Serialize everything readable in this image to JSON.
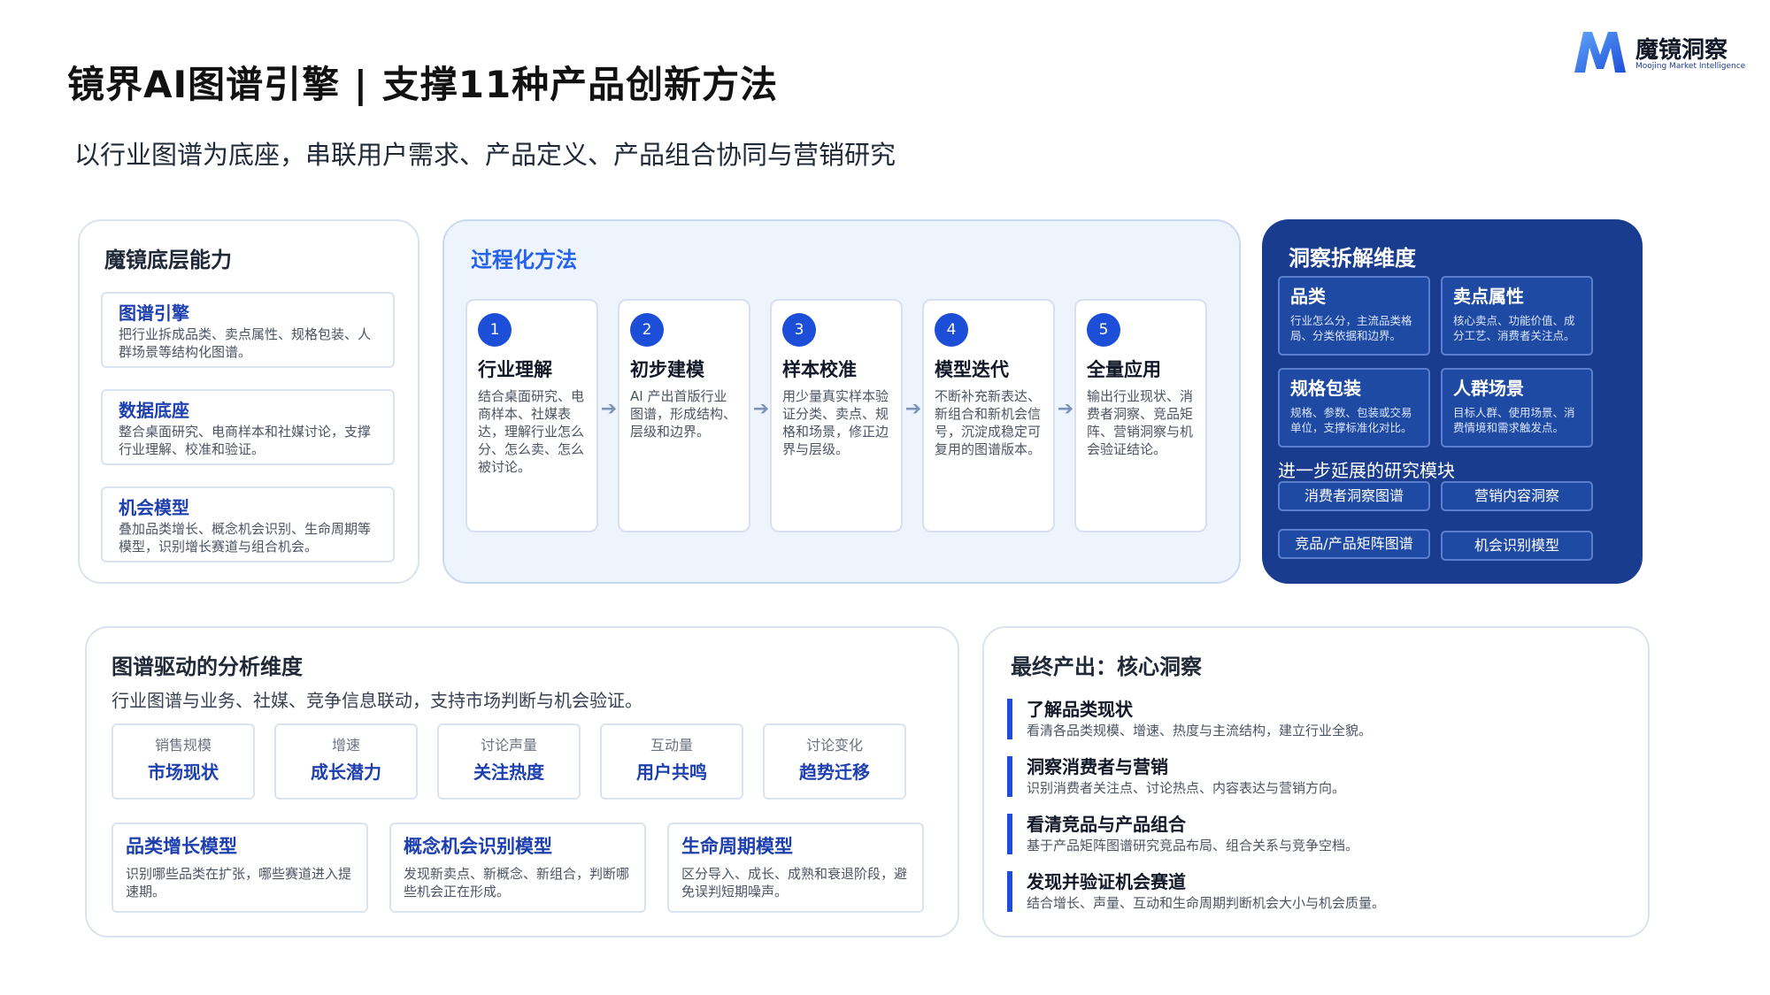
{
  "header": {
    "title": "镜界AI图谱引擎 | 支撑11种产品创新方法",
    "subtitle": "以行业图谱为底座，串联用户需求、产品定义、产品组合协同与营销研究"
  },
  "logo": {
    "name_cn": "魔镜洞察",
    "name_en": "Moojing Market Intelligence",
    "icon": "m-logo-icon"
  },
  "capabilities": {
    "title": "魔镜底层能力",
    "items": [
      {
        "title": "图谱引擎",
        "desc": "把行业拆成品类、卖点属性、规格包装、人群场景等结构化图谱。"
      },
      {
        "title": "数据底座",
        "desc": "整合桌面研究、电商样本和社媒讨论，支撑行业理解、校准和验证。"
      },
      {
        "title": "机会模型",
        "desc": "叠加品类增长、概念机会识别、生命周期等模型，识别增长赛道与组合机会。"
      }
    ]
  },
  "process": {
    "title": "过程化方法",
    "steps": [
      {
        "num": "1",
        "title": "行业理解",
        "desc": "结合桌面研究、电商样本、社媒表达，理解行业怎么分、怎么卖、怎么被讨论。"
      },
      {
        "num": "2",
        "title": "初步建模",
        "desc": "AI 产出首版行业图谱，形成结构、层级和边界。"
      },
      {
        "num": "3",
        "title": "样本校准",
        "desc": "用少量真实样本验证分类、卖点、规格和场景，修正边界与层级。"
      },
      {
        "num": "4",
        "title": "模型迭代",
        "desc": "不断补充新表达、新组合和新机会信号，沉淀成稳定可复用的图谱版本。"
      },
      {
        "num": "5",
        "title": "全量应用",
        "desc": "输出行业现状、消费者洞察、竞品矩阵、营销洞察与机会验证结论。"
      }
    ],
    "arrow_icon": "arrow-right-icon"
  },
  "insight": {
    "title": "洞察拆解维度",
    "cards": [
      {
        "title": "品类",
        "desc": "行业怎么分，主流品类格局、分类依据和边界。"
      },
      {
        "title": "卖点属性",
        "desc": "核心卖点、功能价值、成分工艺、消费者关注点。"
      },
      {
        "title": "规格包装",
        "desc": "规格、参数、包装或交易单位，支撑标准化对比。"
      },
      {
        "title": "人群场景",
        "desc": "目标人群、使用场景、消费情境和需求触发点。"
      }
    ],
    "extension_title": "进一步延展的研究模块",
    "extensions": [
      "消费者洞察图谱",
      "营销内容洞察",
      "竞品/产品矩阵图谱",
      "机会识别模型"
    ]
  },
  "analysis": {
    "title": "图谱驱动的分析维度",
    "subtitle": "行业图谱与业务、社媒、竞争信息联动，支持市场判断与机会验证。",
    "metrics": [
      {
        "label": "销售规模",
        "value": "市场现状"
      },
      {
        "label": "增速",
        "value": "成长潜力"
      },
      {
        "label": "讨论声量",
        "value": "关注热度"
      },
      {
        "label": "互动量",
        "value": "用户共鸣"
      },
      {
        "label": "讨论变化",
        "value": "趋势迁移"
      }
    ],
    "models": [
      {
        "title": "品类增长模型",
        "desc": "识别哪些品类在扩张，哪些赛道进入提速期。"
      },
      {
        "title": "概念机会识别模型",
        "desc": "发现新卖点、新概念、新组合，判断哪些机会正在形成。"
      },
      {
        "title": "生命周期模型",
        "desc": "区分导入、成长、成熟和衰退阶段，避免误判短期噪声。"
      }
    ]
  },
  "output": {
    "title": "最终产出：核心洞察",
    "items": [
      {
        "title": "了解品类现状",
        "desc": "看清各品类规模、增速、热度与主流结构，建立行业全貌。"
      },
      {
        "title": "洞察消费者与营销",
        "desc": "识别消费者关注点、讨论热点、内容表达与营销方向。"
      },
      {
        "title": "看清竞品与产品组合",
        "desc": "基于产品矩阵图谱研究竞品布局、组合关系与竞争空档。"
      },
      {
        "title": "发现并验证机会赛道",
        "desc": "结合增长、声量、互动和生命周期判断机会大小与机会质量。"
      }
    ]
  },
  "colors": {
    "accent": "#1d4ed8",
    "dark_panel": "#1a3c8f",
    "process_bg": "#eef4fc"
  }
}
